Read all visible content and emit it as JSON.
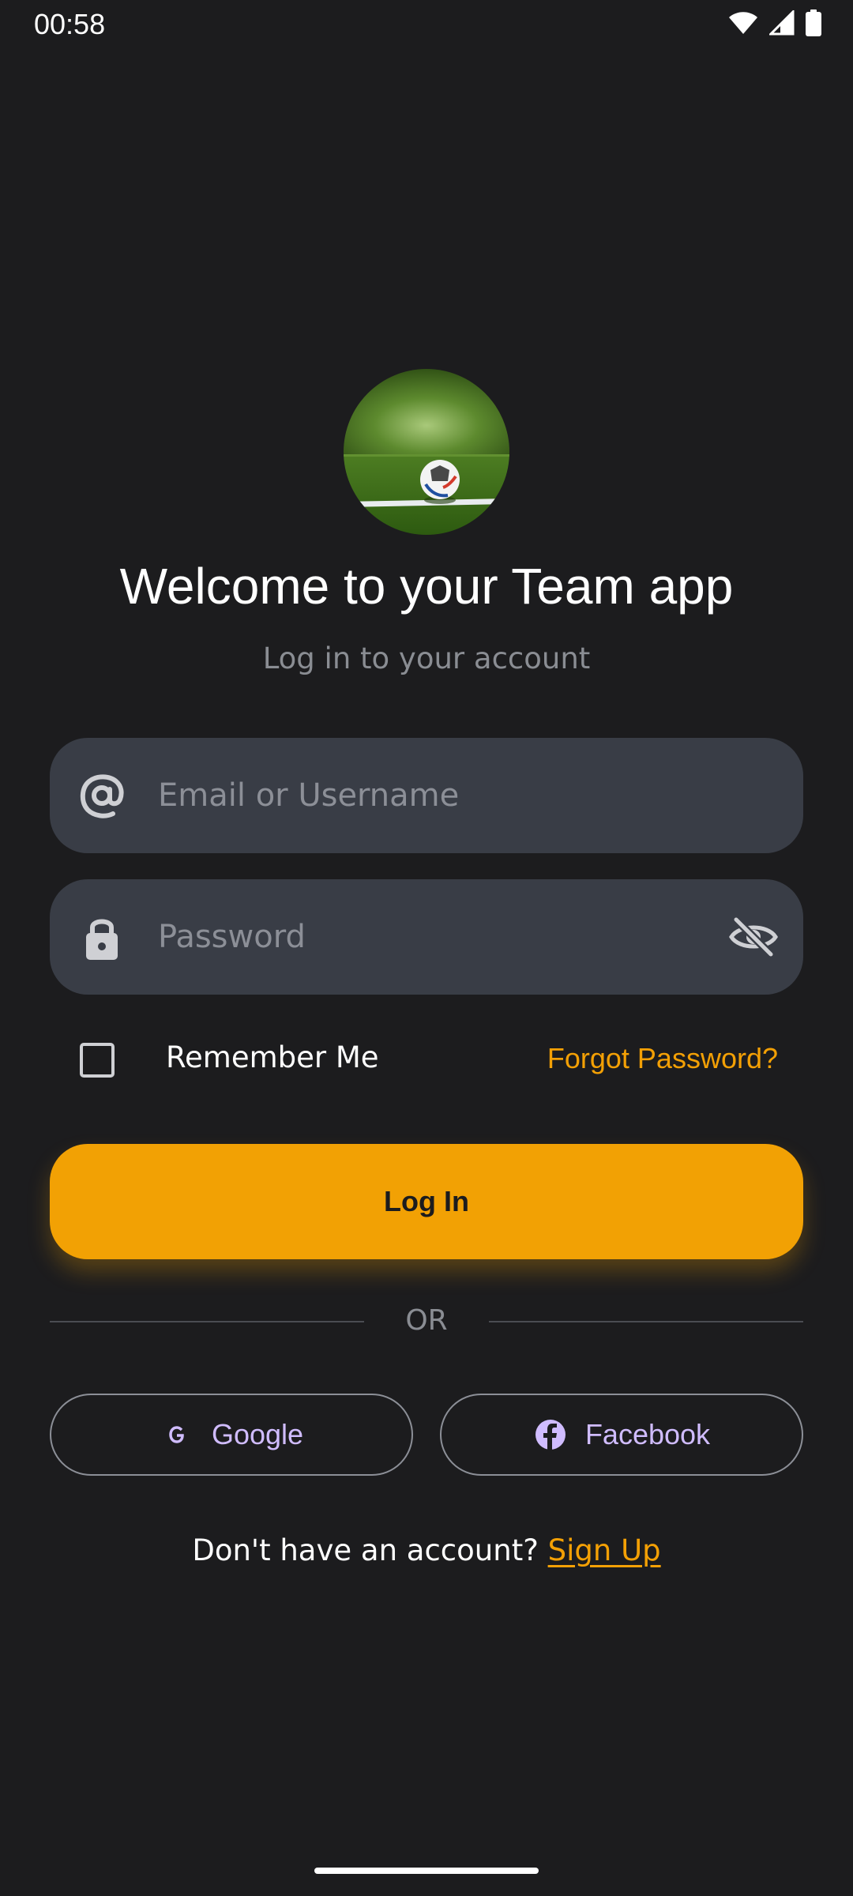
{
  "status_bar": {
    "time": "00:58",
    "icons": [
      "wifi-icon",
      "signal-icon",
      "battery-icon"
    ]
  },
  "hero": {
    "image": "soccer-ball-on-field"
  },
  "title": "Welcome to your Team app",
  "subtitle": "Log in to your account",
  "email_field": {
    "icon": "at-icon",
    "placeholder": "Email or Username",
    "value": ""
  },
  "password_field": {
    "icon": "lock-icon",
    "placeholder": "Password",
    "value": "",
    "visibility_icon": "eye-off-icon"
  },
  "remember_me": {
    "label": "Remember Me",
    "checked": false
  },
  "forgot_password": "Forgot Password?",
  "login_button": "Log In",
  "divider": "OR",
  "social": {
    "google": "Google",
    "facebook": "Facebook"
  },
  "signup": {
    "prompt": "Don't have an account?",
    "link": "Sign Up"
  },
  "colors": {
    "background": "#1c1c1e",
    "accent": "#f2a104",
    "field": "#393d46",
    "social_text": "#d0bcff"
  }
}
